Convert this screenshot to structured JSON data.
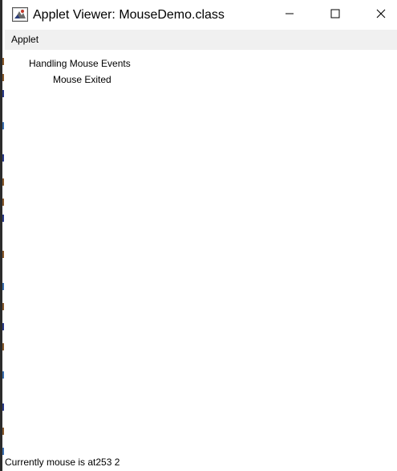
{
  "window": {
    "title": "Applet Viewer: MouseDemo.class",
    "icon": "java-applet-icon",
    "controls": {
      "minimize_icon": "minimize-icon",
      "maximize_icon": "maximize-icon",
      "close_icon": "close-icon"
    }
  },
  "menubar": {
    "items": [
      {
        "label": "Applet"
      }
    ]
  },
  "applet": {
    "heading": "Handling Mouse Events",
    "event_message": "Mouse Exited"
  },
  "status": {
    "text": "Currently mouse is at253 2"
  },
  "colors": {
    "titlebar_bg": "#ffffff",
    "menubar_bg": "#f0f0f0",
    "canvas_bg": "#ffffff",
    "text": "#000000"
  }
}
